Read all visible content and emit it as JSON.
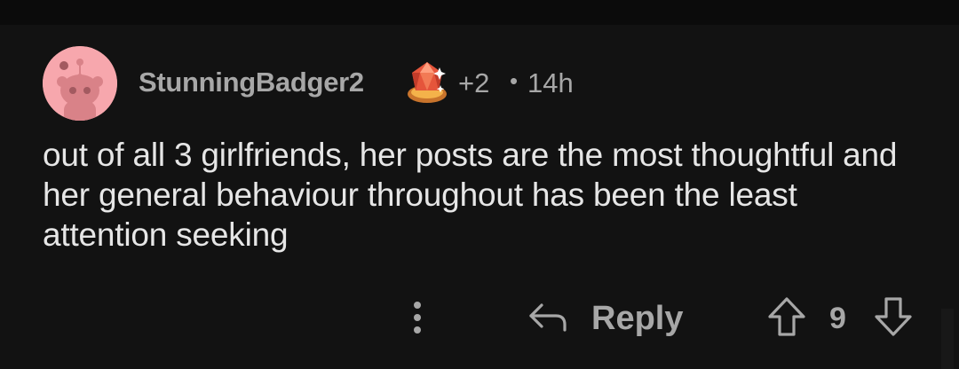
{
  "comment": {
    "username": "StunningBadger2",
    "award_count": "+2",
    "separator": "•",
    "timestamp": "14h",
    "body": "out of all 3 girlfriends, her posts are the most thoughtful and her general behaviour throughout has been the least attention seeking",
    "avatar_color": "#f7a7ad"
  },
  "actions": {
    "more_icon": "more-vertical-icon",
    "reply_icon": "reply-arrow-icon",
    "reply_label": "Reply",
    "upvote_icon": "upvote-arrow-icon",
    "score": "9",
    "downvote_icon": "downvote-arrow-icon"
  },
  "colors": {
    "background": "#121212",
    "text_primary": "#e6e6e6",
    "text_secondary": "#a7a7a7"
  }
}
